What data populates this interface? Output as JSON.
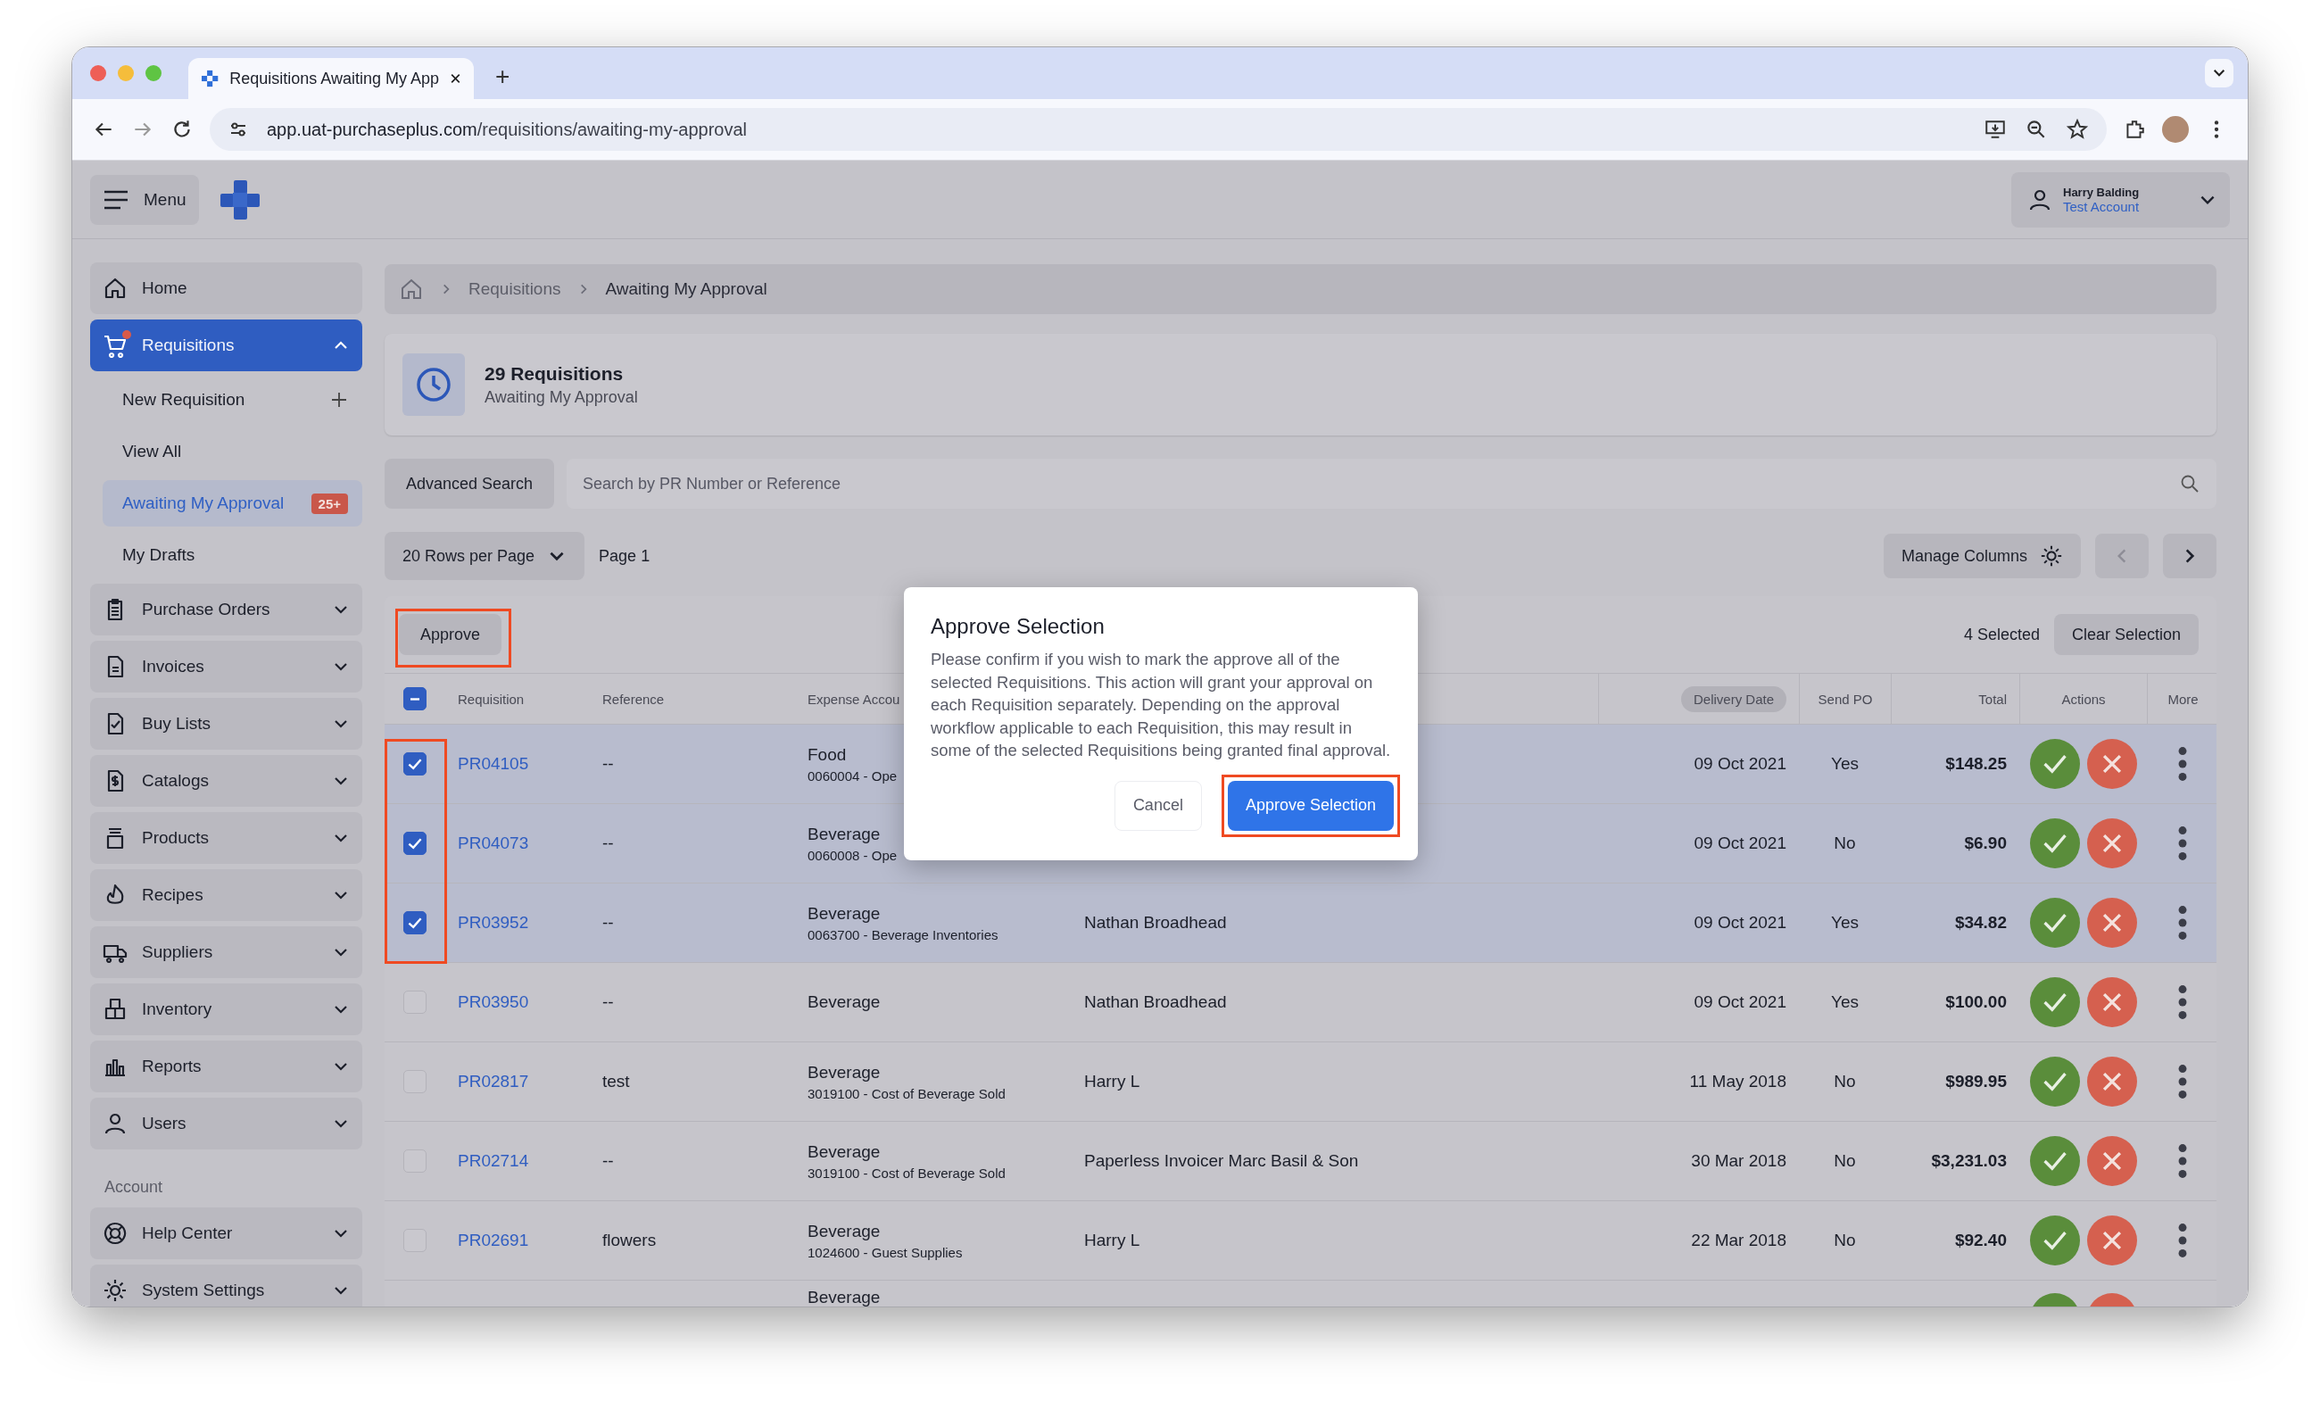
{
  "browser": {
    "tab_title": "Requisitions Awaiting My App",
    "new_tab": "+",
    "url_host": "app.uat-purchaseplus.com",
    "url_path": "/requisitions/awaiting-my-approval"
  },
  "header": {
    "menu_label": "Menu",
    "user_name": "Harry Balding",
    "account": "Test Account"
  },
  "sidebar": {
    "items": [
      {
        "label": "Home",
        "kind": "link",
        "selected": false
      },
      {
        "label": "Requisitions",
        "kind": "group",
        "selected": true,
        "expanded": true,
        "children": [
          {
            "label": "New Requisition",
            "kind": "add",
            "selected": false
          },
          {
            "label": "View All",
            "kind": "link",
            "selected": false
          },
          {
            "label": "Awaiting My Approval",
            "kind": "link",
            "selected": true,
            "badge": "25+"
          },
          {
            "label": "My Drafts",
            "kind": "link",
            "selected": false
          }
        ]
      },
      {
        "label": "Purchase Orders",
        "kind": "group",
        "selected": false,
        "expanded": false
      },
      {
        "label": "Invoices",
        "kind": "group",
        "selected": false,
        "expanded": false
      },
      {
        "label": "Buy Lists",
        "kind": "group",
        "selected": false,
        "expanded": false
      },
      {
        "label": "Catalogs",
        "kind": "group",
        "selected": false,
        "expanded": false
      },
      {
        "label": "Products",
        "kind": "group",
        "selected": false,
        "expanded": false
      },
      {
        "label": "Recipes",
        "kind": "group",
        "selected": false,
        "expanded": false
      },
      {
        "label": "Suppliers",
        "kind": "group",
        "selected": false,
        "expanded": false
      },
      {
        "label": "Inventory",
        "kind": "group",
        "selected": false,
        "expanded": false
      },
      {
        "label": "Reports",
        "kind": "group",
        "selected": false,
        "expanded": false
      },
      {
        "label": "Users",
        "kind": "group",
        "selected": false,
        "expanded": false
      }
    ],
    "section_label": "Account",
    "account_items": [
      {
        "label": "Help Center",
        "kind": "group",
        "selected": false,
        "expanded": false
      },
      {
        "label": "System Settings",
        "kind": "group",
        "selected": false,
        "expanded": false
      }
    ]
  },
  "breadcrumb": [
    "Requisitions",
    "Awaiting My Approval"
  ],
  "summary": {
    "count": "29 Requisitions",
    "subtitle": "Awaiting My Approval"
  },
  "search": {
    "advanced_label": "Advanced Search",
    "placeholder": "Search by PR Number or Reference"
  },
  "pagination": {
    "rows_per_page": "20 Rows per Page",
    "page": "Page 1",
    "manage_columns": "Manage Columns"
  },
  "table": {
    "approve_label": "Approve",
    "selected_count": "4 Selected",
    "clear_label": "Clear Selection",
    "select_all_partial": true,
    "columns": [
      {
        "label": "Requisition",
        "sorted": false
      },
      {
        "label": "Reference",
        "sorted": false
      },
      {
        "label": "Expense Accou",
        "sorted": false
      },
      {
        "label": "Delivery Date",
        "sorted": true
      },
      {
        "label": "Send PO",
        "sorted": false
      },
      {
        "label": "Total",
        "sorted": false
      },
      {
        "label": "Actions",
        "sorted": false
      },
      {
        "label": "More",
        "sorted": false
      }
    ],
    "rows": [
      {
        "checked": true,
        "number": "PR04105",
        "reference": "--",
        "category": "Food",
        "account": "0060004 - Ope",
        "requester": "",
        "delivery": "09 Oct 2021",
        "send_po": "Yes",
        "total": "$148.25"
      },
      {
        "checked": true,
        "number": "PR04073",
        "reference": "--",
        "category": "Beverage",
        "account": "0060008 - Ope",
        "requester": "",
        "delivery": "09 Oct 2021",
        "send_po": "No",
        "total": "$6.90"
      },
      {
        "checked": true,
        "number": "PR03952",
        "reference": "--",
        "category": "Beverage",
        "account": "0063700 - Beverage Inventories",
        "requester": "Nathan Broadhead",
        "delivery": "09 Oct 2021",
        "send_po": "Yes",
        "total": "$34.82"
      },
      {
        "checked": false,
        "number": "PR03950",
        "reference": "--",
        "category": "Beverage",
        "account": "",
        "requester": "Nathan Broadhead",
        "delivery": "09 Oct 2021",
        "send_po": "Yes",
        "total": "$100.00"
      },
      {
        "checked": false,
        "number": "PR02817",
        "reference": "test",
        "category": "Beverage",
        "account": "3019100 - Cost of Beverage Sold",
        "requester": "Harry L",
        "delivery": "11 May 2018",
        "send_po": "No",
        "total": "$989.95"
      },
      {
        "checked": false,
        "number": "PR02714",
        "reference": "--",
        "category": "Beverage",
        "account": "3019100 - Cost of Beverage Sold",
        "requester": "Paperless Invoicer Marc Basil & Son",
        "delivery": "30 Mar 2018",
        "send_po": "No",
        "total": "$3,231.03"
      },
      {
        "checked": false,
        "number": "PR02691",
        "reference": "flowers",
        "category": "Beverage",
        "account": "1024600 - Guest Supplies",
        "requester": "Harry L",
        "delivery": "22 Mar 2018",
        "send_po": "No",
        "total": "$92.40"
      }
    ],
    "partial_row": {
      "category": "Beverage"
    }
  },
  "dialog": {
    "title": "Approve Selection",
    "message": "Please confirm if you wish to mark the approve all of the selected Requisitions. This action will grant your approval on each Requisition separately. Depending on the approval workflow applicable to each Requisition, this may result in some of the selected Requisitions being granted final approval.",
    "cancel": "Cancel",
    "confirm": "Approve Selection"
  }
}
